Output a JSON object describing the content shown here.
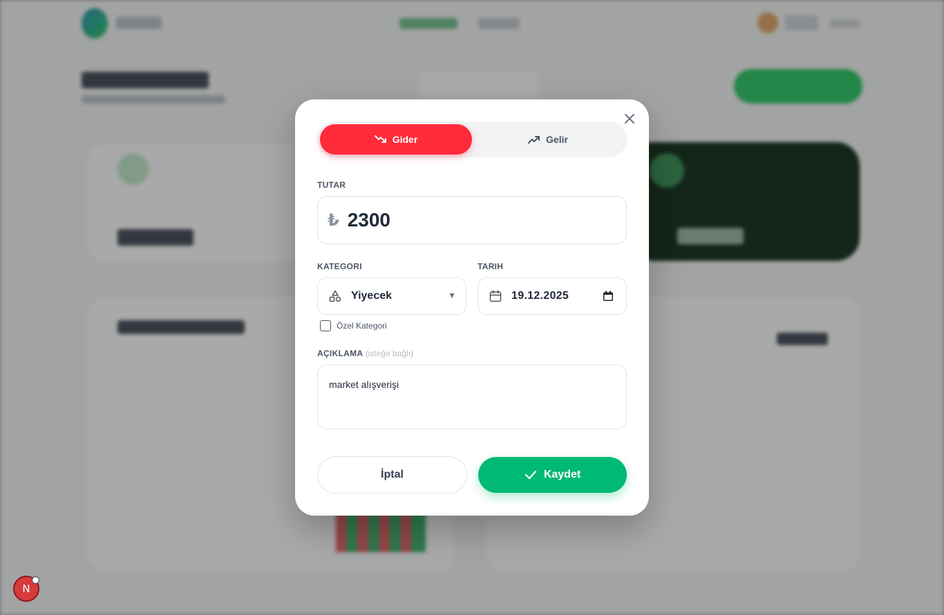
{
  "modal": {
    "type_toggle": {
      "expense_label": "Gider",
      "income_label": "Gelir",
      "selected": "expense"
    },
    "amount": {
      "label": "TUTAR",
      "currency_symbol": "₺",
      "value": "2300"
    },
    "category": {
      "label": "KATEGORI",
      "value": "Yiyecek",
      "icon": "shapes-icon"
    },
    "date": {
      "label": "TARIH",
      "value": "19.12.2025",
      "icon": "calendar-icon"
    },
    "custom_category": {
      "label": "Özel Kategori",
      "checked": false
    },
    "description": {
      "label": "AÇIKLAMA",
      "optional_hint": "(isteğe bağlı)",
      "value": "market alışverişi"
    },
    "buttons": {
      "cancel_label": "İptal",
      "save_label": "Kaydet"
    }
  },
  "dev_badge": {
    "letter": "N"
  },
  "colors": {
    "expense_red": "#ff2b3a",
    "save_green": "#00b975",
    "brand_green": "#22c55e"
  }
}
